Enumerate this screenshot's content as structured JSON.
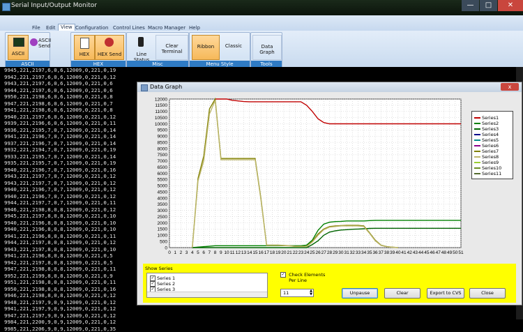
{
  "window": {
    "title": "Serial Input/Output Monitor"
  },
  "menu": {
    "tabs": [
      "File",
      "Edit",
      "View",
      "Configuration",
      "Control Lines",
      "Macro Manager",
      "Help"
    ],
    "selected": "View"
  },
  "ribbon": {
    "ascii_group": {
      "label": "ASCII",
      "ascii": "ASCII",
      "ascii_send": "ASCII Send"
    },
    "hex_group": {
      "label": "HEX",
      "hex": "HEX",
      "hex_send": "HEX Send"
    },
    "misc_group": {
      "label": "Misc",
      "line_status": "Line Status",
      "clear_terminal": "Clear Terminal"
    },
    "menu_style_group": {
      "label": "Menu Style",
      "ribbon": "Ribbon",
      "classic": "Classic"
    },
    "tools_group": {
      "label": "Tools",
      "data_graph": "Data Graph"
    }
  },
  "terminal": {
    "lines": [
      "9945,221,2197,6,0,6,12009,0,221,0,19",
      "9942,221,2197,6,0,6,12009,0,221,0,12",
      "9943,221,2197,6,0,6,12009,0,221,0,6",
      "9944,221,2197,6,0,6,12009,0,221,0,6",
      "9950,221,2198,6,0,6,12009,0,221,0,8",
      "9947,221,2198,6,0,6,12009,0,221,0,7",
      "9941,221,2198,6,0,6,12009,0,221,0,8",
      "9940,221,2197,6,0,6,12009,0,221,0,12",
      "9939,221,2196,6,0,6,12009,0,221,0,11",
      "9936,221,2195,7,0,7,12009,0,221,0,14",
      "9941,221,2196,7,0,7,12009,0,221,0,14",
      "9937,221,2196,7,0,7,12009,0,221,0,14",
      "9932,221,2194,7,0,7,12009,0,221,0,19",
      "9933,221,2195,7,0,7,12009,0,221,0,14",
      "9935,221,2195,7,0,7,12009,0,221,0,19",
      "9940,221,2196,7,0,7,12009,0,221,0,16",
      "9943,221,2197,7,0,7,12009,0,221,0,12",
      "9943,221,2197,7,0,7,12009,0,221,0,12",
      "9940,221,2196,7,0,7,12009,0,221,0,12",
      "9940,221,2196,7,0,7,12009,0,221,0,12",
      "9944,221,2197,7,0,7,12009,0,221,0,11",
      "9946,221,2198,8,0,8,12009,0,221,0,12",
      "9945,221,2197,8,0,8,12009,0,221,0,10",
      "9940,221,2196,8,0,8,12009,0,221,0,10",
      "9940,221,2196,8,0,8,12009,0,221,0,10",
      "9941,221,2196,8,0,8,12009,0,221,0,11",
      "9944,221,2197,8,0,8,12009,0,221,0,12",
      "9943,221,2197,8,0,8,12009,0,221,0,10",
      "9941,221,2196,8,0,8,12009,0,221,0,5",
      "9942,221,2197,8,0,8,12009,0,221,0,5",
      "9947,221,2198,8,0,8,12009,0,221,0,11",
      "9952,221,2199,8,0,8,12009,0,221,0,9",
      "9951,221,2198,8,0,8,12009,0,221,0,11",
      "9950,221,2198,8,0,8,12009,0,221,0,16",
      "9946,221,2198,8,0,8,12009,0,221,0,12",
      "9948,221,2197,9,0,9,12009,0,221,0,12",
      "9941,221,2197,9,0,9,12009,0,221,0,12",
      "9947,221,2197,9,0,9,12009,0,221,0,12",
      "9984,221,2200,9,0,9,12009,0,221,0,12",
      "9985,221,2206,9,0,9,12009,0,221,0,35"
    ]
  },
  "graph_window": {
    "title": "Data Graph",
    "show_series_label": "Show Series",
    "series_list": [
      "Series 1",
      "Series 2",
      "Series 3"
    ],
    "check_elements_label": "Check Elements",
    "per_line_label": "Per Line",
    "per_line_value": "11",
    "buttons": {
      "unpause": "Unpause",
      "clear": "Clear",
      "export": "Export to CVS",
      "close": "Close"
    },
    "close_glyph": "x"
  },
  "chart_data": {
    "type": "line",
    "title": "",
    "xlabel": "",
    "ylabel": "",
    "ylim": [
      0,
      12000
    ],
    "xlim": [
      0,
      51
    ],
    "yticks": [
      0,
      500,
      1000,
      1500,
      2000,
      2500,
      3000,
      3500,
      4000,
      4500,
      5000,
      5500,
      6000,
      6500,
      7000,
      7500,
      8000,
      8500,
      9000,
      9500,
      10000,
      10500,
      11000,
      11500,
      12000
    ],
    "xticks": [
      0,
      1,
      2,
      3,
      4,
      5,
      6,
      7,
      8,
      9,
      10,
      11,
      12,
      13,
      14,
      15,
      16,
      17,
      18,
      19,
      20,
      21,
      22,
      23,
      24,
      25,
      26,
      27,
      28,
      29,
      30,
      31,
      32,
      33,
      34,
      35,
      36,
      37,
      38,
      39,
      40,
      41,
      42,
      43,
      44,
      45,
      46,
      47,
      48,
      49,
      50,
      51
    ],
    "grid": true,
    "legend_position": "right",
    "series": [
      {
        "name": "Series1",
        "color": "#c00000",
        "x": [
          8,
          9,
          10,
          11,
          12,
          13,
          14,
          15,
          16,
          17,
          18,
          19,
          20,
          21,
          22,
          23,
          24,
          25,
          26,
          27,
          28,
          29,
          30,
          31,
          32,
          33,
          34,
          35,
          36,
          37,
          38,
          39,
          40,
          41,
          42,
          43,
          44,
          45,
          46,
          47,
          48,
          49,
          50,
          51
        ],
        "values": [
          12000,
          12000,
          12000,
          11900,
          11850,
          11800,
          11780,
          11780,
          11780,
          11780,
          11780,
          11780,
          11780,
          11780,
          11780,
          11780,
          11500,
          11000,
          10400,
          10100,
          10000,
          10000,
          10000,
          10000,
          10000,
          10000,
          10000,
          10000,
          10000,
          10000,
          10000,
          10000,
          10000,
          10000,
          10000,
          10000,
          10000,
          10000,
          10000,
          10000,
          10000,
          10000,
          10000,
          10000
        ]
      },
      {
        "name": "Series2",
        "color": "#008000",
        "x": [
          4,
          8,
          16,
          17,
          18,
          19,
          20,
          21,
          22,
          23,
          24,
          25,
          26,
          27,
          28,
          29,
          30,
          31,
          32,
          33,
          34,
          35,
          36,
          37,
          38,
          39,
          40,
          41,
          42,
          43,
          44,
          45,
          46,
          47,
          48,
          49,
          50,
          51
        ],
        "values": [
          0,
          150,
          150,
          150,
          150,
          150,
          150,
          150,
          150,
          150,
          200,
          600,
          1400,
          1900,
          2050,
          2100,
          2120,
          2150,
          2150,
          2150,
          2150,
          2180,
          2200,
          2200,
          2200,
          2200,
          2200,
          2200,
          2200,
          2200,
          2200,
          2200,
          2200,
          2200,
          2200,
          2200,
          2200,
          2200
        ]
      },
      {
        "name": "Series3",
        "color": "#006400",
        "x": [
          4,
          16,
          17,
          18,
          19,
          20,
          21,
          22,
          23,
          24,
          25,
          26,
          27,
          28,
          29,
          30,
          31,
          32,
          33,
          34,
          35,
          36,
          37,
          38,
          39,
          40,
          41,
          42,
          43,
          44,
          45,
          46,
          47,
          48,
          49,
          50,
          51
        ],
        "values": [
          0,
          0,
          0,
          0,
          0,
          0,
          0,
          0,
          0,
          0,
          250,
          550,
          1000,
          1250,
          1350,
          1420,
          1450,
          1480,
          1500,
          1520,
          1550,
          1560,
          1560,
          1560,
          1560,
          1560,
          1560,
          1560,
          1560,
          1560,
          1560,
          1560,
          1560,
          1560,
          1560,
          1560,
          1560
        ]
      },
      {
        "name": "Series4",
        "color": "#00008b",
        "x": [],
        "values": []
      },
      {
        "name": "Series5",
        "color": "#008b8b",
        "x": [],
        "values": []
      },
      {
        "name": "Series6",
        "color": "#8b008b",
        "x": [],
        "values": []
      },
      {
        "name": "Series7",
        "color": "#808000",
        "x": [
          4,
          5,
          6,
          7,
          8,
          9,
          10,
          11,
          12,
          13,
          14,
          15,
          16,
          17,
          18,
          19,
          20,
          21,
          22,
          23,
          24,
          25,
          26,
          27,
          28,
          29,
          30,
          31,
          32,
          33,
          34,
          35,
          36,
          37,
          38,
          39,
          40
        ],
        "values": [
          0,
          5600,
          7400,
          11200,
          12000,
          7200,
          7200,
          7200,
          7200,
          7200,
          7200,
          7200,
          4000,
          200,
          200,
          200,
          180,
          150,
          100,
          100,
          100,
          500,
          1100,
          1500,
          1700,
          1750,
          1780,
          1800,
          1800,
          1800,
          1750,
          1200,
          600,
          200,
          80,
          40,
          0
        ]
      },
      {
        "name": "Series8",
        "color": "#bdb76b",
        "x": [
          4,
          5,
          6,
          7,
          8,
          9,
          10,
          11,
          12,
          13,
          14,
          15,
          16,
          17,
          18,
          19,
          20,
          21,
          22,
          23,
          24,
          25,
          26,
          27,
          28,
          29,
          30,
          31,
          32,
          33,
          34,
          35,
          36,
          37,
          38,
          39,
          40
        ],
        "values": [
          0,
          5400,
          7000,
          10800,
          11900,
          7100,
          7100,
          7100,
          7100,
          7100,
          7100,
          7100,
          3900,
          180,
          180,
          180,
          160,
          140,
          90,
          90,
          90,
          450,
          1000,
          1450,
          1650,
          1700,
          1750,
          1750,
          1750,
          1750,
          1700,
          1150,
          550,
          180,
          70,
          30,
          0
        ]
      },
      {
        "name": "Series9",
        "color": "#9acd32",
        "x": [],
        "values": []
      },
      {
        "name": "Series10",
        "color": "#6b8e23",
        "x": [],
        "values": []
      },
      {
        "name": "Series11",
        "color": "#556b2f",
        "x": [],
        "values": []
      }
    ]
  }
}
